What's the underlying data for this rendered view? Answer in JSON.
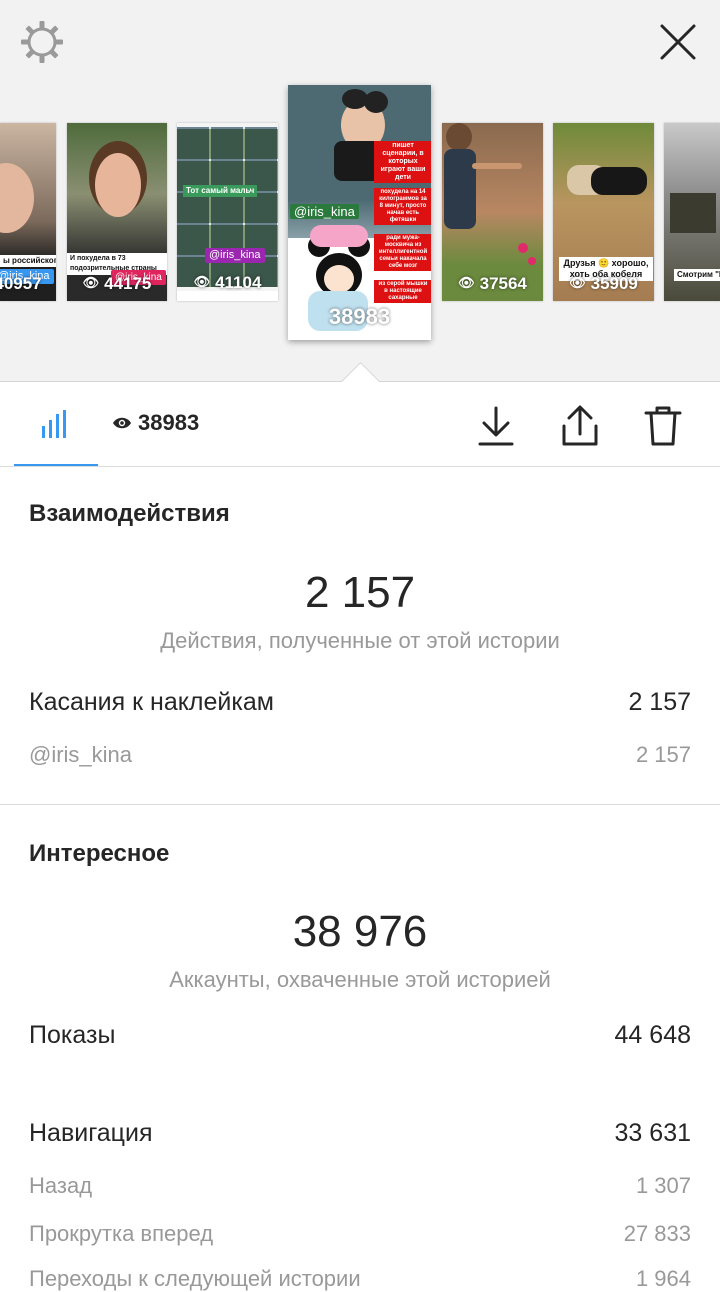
{
  "header": {
    "settings_icon": "gear-icon",
    "close_icon": "close-icon"
  },
  "stories": [
    {
      "views": "40957",
      "tag": "@iris_kina",
      "caption": "ы российского"
    },
    {
      "views": "44175",
      "tag": "@iris_kina",
      "caption": "И похудела в 73 подозрительные страны"
    },
    {
      "views": "41104",
      "tag": "@iris_kina",
      "caption": "Тот самый мальч"
    },
    {
      "views": "38983",
      "tag": "@iris_kina",
      "captions": [
        "пишет сценарии, в которых играют ваши дети",
        "похудела на 14 килограммов за 8 минут, просто начав есть фетяшки",
        "ради мужа-москвича из интеллигентной семьи накачала себе мозг",
        "из серой мышки в настоящие сахарные"
      ]
    },
    {
      "views": "37564"
    },
    {
      "views": "35909",
      "caption": "Друзья 🙂 хорошо, хоть оба кобеля"
    },
    {
      "caption": "Смотрим \"Ка..."
    }
  ],
  "tabs": {
    "insights_icon": "bar-chart-icon",
    "views_icon": "eye-icon",
    "views_value": "38983",
    "download_icon": "download-icon",
    "share_icon": "share-icon",
    "delete_icon": "trash-icon"
  },
  "interactions": {
    "title": "Взаимодействия",
    "total": "2 157",
    "total_label": "Действия, полученные от этой истории",
    "sticker_taps_label": "Касания к наклейкам",
    "sticker_taps_value": "2 157",
    "mention_label": "@iris_kina",
    "mention_value": "2 157"
  },
  "discovery": {
    "title": "Интересное",
    "reach": "38 976",
    "reach_label": "Аккаунты, охваченные этой историей",
    "impressions_label": "Показы",
    "impressions_value": "44 648",
    "navigation_label": "Навигация",
    "navigation_value": "33 631",
    "back_label": "Назад",
    "back_value": "1 307",
    "forward_label": "Прокрутка вперед",
    "forward_value": "27 833",
    "next_story_label": "Переходы к следующей истории",
    "next_story_value": "1 964"
  },
  "colors": {
    "accent": "#3897f0",
    "secondary_text": "#999999",
    "primary_text": "#262626"
  }
}
